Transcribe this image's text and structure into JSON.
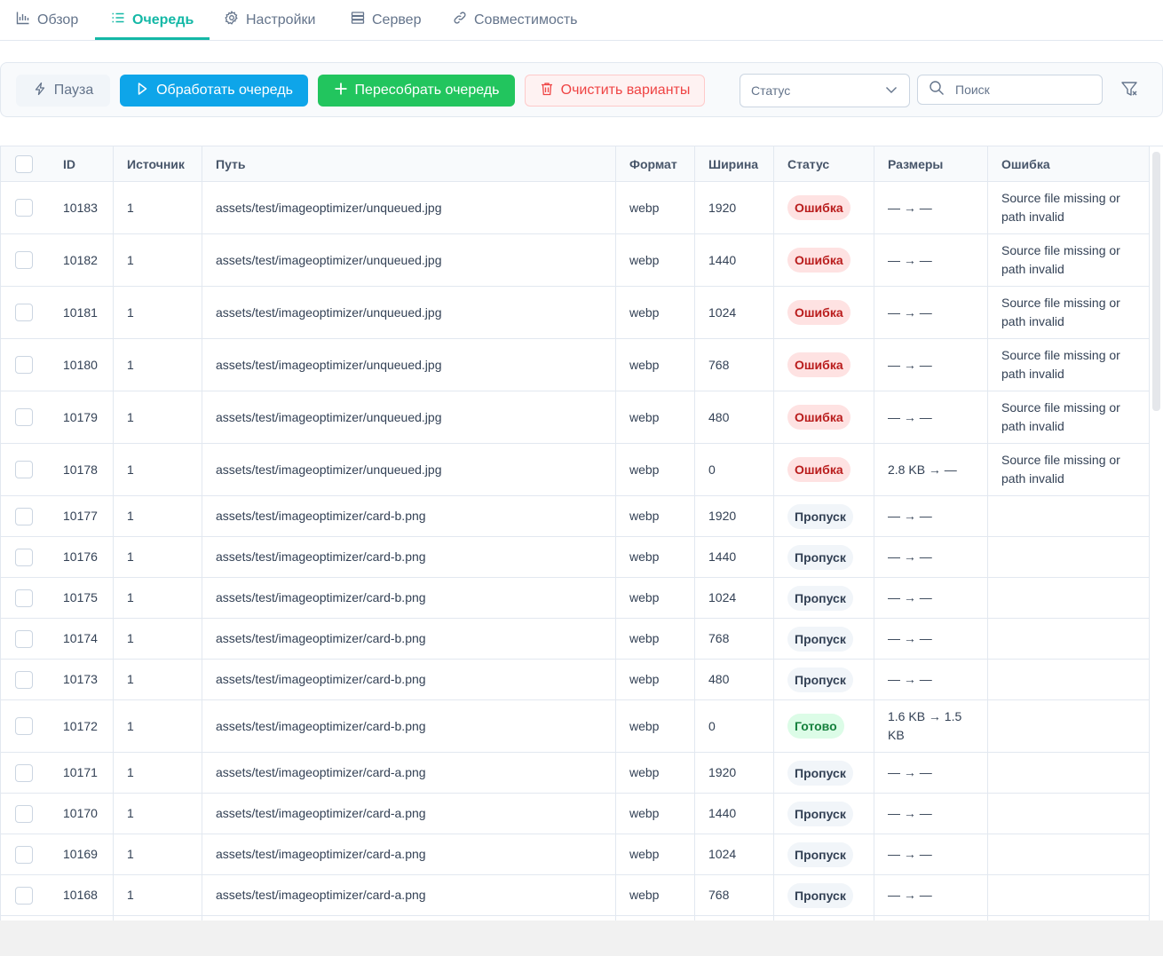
{
  "tabs": [
    {
      "label": "Обзор",
      "icon": "bar-chart-icon"
    },
    {
      "label": "Очередь",
      "icon": "list-icon"
    },
    {
      "label": "Настройки",
      "icon": "gear-icon"
    },
    {
      "label": "Сервер",
      "icon": "server-icon"
    },
    {
      "label": "Совместимость",
      "icon": "link-icon"
    }
  ],
  "active_tab": "Очередь",
  "toolbar": {
    "pause_label": "Пауза",
    "process_label": "Обработать очередь",
    "rebuild_label": "Пересобрать очередь",
    "clear_label": "Очистить варианты",
    "status_select": "Статус",
    "search_placeholder": "Поиск"
  },
  "colors": {
    "accent": "#14b8a6",
    "process": "#0ea5e9",
    "rebuild": "#22c55e",
    "danger": "#ef4444"
  },
  "table": {
    "headers": [
      "ID",
      "Источник",
      "Путь",
      "Формат",
      "Ширина",
      "Статус",
      "Размеры",
      "Ошибка"
    ],
    "rows": [
      {
        "id": "10183",
        "source": "1",
        "path": "assets/test/imageoptimizer/unqueued.jpg",
        "format": "webp",
        "width": "1920",
        "status": "Ошибка",
        "status_type": "error",
        "sizes": "— → —",
        "error": "Source file missing or path invalid"
      },
      {
        "id": "10182",
        "source": "1",
        "path": "assets/test/imageoptimizer/unqueued.jpg",
        "format": "webp",
        "width": "1440",
        "status": "Ошибка",
        "status_type": "error",
        "sizes": "— → —",
        "error": "Source file missing or path invalid"
      },
      {
        "id": "10181",
        "source": "1",
        "path": "assets/test/imageoptimizer/unqueued.jpg",
        "format": "webp",
        "width": "1024",
        "status": "Ошибка",
        "status_type": "error",
        "sizes": "— → —",
        "error": "Source file missing or path invalid"
      },
      {
        "id": "10180",
        "source": "1",
        "path": "assets/test/imageoptimizer/unqueued.jpg",
        "format": "webp",
        "width": "768",
        "status": "Ошибка",
        "status_type": "error",
        "sizes": "— → —",
        "error": "Source file missing or path invalid"
      },
      {
        "id": "10179",
        "source": "1",
        "path": "assets/test/imageoptimizer/unqueued.jpg",
        "format": "webp",
        "width": "480",
        "status": "Ошибка",
        "status_type": "error",
        "sizes": "— → —",
        "error": "Source file missing or path invalid"
      },
      {
        "id": "10178",
        "source": "1",
        "path": "assets/test/imageoptimizer/unqueued.jpg",
        "format": "webp",
        "width": "0",
        "status": "Ошибка",
        "status_type": "error",
        "sizes": "2.8 KB → —",
        "error": "Source file missing or path invalid"
      },
      {
        "id": "10177",
        "source": "1",
        "path": "assets/test/imageoptimizer/card-b.png",
        "format": "webp",
        "width": "1920",
        "status": "Пропуск",
        "status_type": "skip",
        "sizes": "— → —",
        "error": ""
      },
      {
        "id": "10176",
        "source": "1",
        "path": "assets/test/imageoptimizer/card-b.png",
        "format": "webp",
        "width": "1440",
        "status": "Пропуск",
        "status_type": "skip",
        "sizes": "— → —",
        "error": ""
      },
      {
        "id": "10175",
        "source": "1",
        "path": "assets/test/imageoptimizer/card-b.png",
        "format": "webp",
        "width": "1024",
        "status": "Пропуск",
        "status_type": "skip",
        "sizes": "— → —",
        "error": ""
      },
      {
        "id": "10174",
        "source": "1",
        "path": "assets/test/imageoptimizer/card-b.png",
        "format": "webp",
        "width": "768",
        "status": "Пропуск",
        "status_type": "skip",
        "sizes": "— → —",
        "error": ""
      },
      {
        "id": "10173",
        "source": "1",
        "path": "assets/test/imageoptimizer/card-b.png",
        "format": "webp",
        "width": "480",
        "status": "Пропуск",
        "status_type": "skip",
        "sizes": "— → —",
        "error": ""
      },
      {
        "id": "10172",
        "source": "1",
        "path": "assets/test/imageoptimizer/card-b.png",
        "format": "webp",
        "width": "0",
        "status": "Готово",
        "status_type": "done",
        "sizes": "1.6 KB → 1.5 KB",
        "error": ""
      },
      {
        "id": "10171",
        "source": "1",
        "path": "assets/test/imageoptimizer/card-a.png",
        "format": "webp",
        "width": "1920",
        "status": "Пропуск",
        "status_type": "skip",
        "sizes": "— → —",
        "error": ""
      },
      {
        "id": "10170",
        "source": "1",
        "path": "assets/test/imageoptimizer/card-a.png",
        "format": "webp",
        "width": "1440",
        "status": "Пропуск",
        "status_type": "skip",
        "sizes": "— → —",
        "error": ""
      },
      {
        "id": "10169",
        "source": "1",
        "path": "assets/test/imageoptimizer/card-a.png",
        "format": "webp",
        "width": "1024",
        "status": "Пропуск",
        "status_type": "skip",
        "sizes": "— → —",
        "error": ""
      },
      {
        "id": "10168",
        "source": "1",
        "path": "assets/test/imageoptimizer/card-a.png",
        "format": "webp",
        "width": "768",
        "status": "Пропуск",
        "status_type": "skip",
        "sizes": "— → —",
        "error": ""
      },
      {
        "id": "",
        "source": "",
        "path": "",
        "format": "",
        "width": "",
        "status": "",
        "status_type": "",
        "sizes": "",
        "error": ""
      }
    ]
  }
}
